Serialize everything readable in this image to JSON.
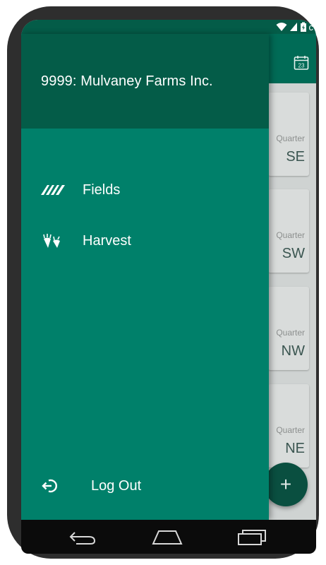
{
  "status_bar": {
    "battery_text": "c"
  },
  "drawer": {
    "account_name": "9999: Mulvaney Farms Inc.",
    "items": [
      {
        "label": "Fields",
        "icon": "fields-icon"
      },
      {
        "label": "Harvest",
        "icon": "harvest-icon"
      }
    ],
    "logout": {
      "label": "Log Out",
      "icon": "logout-icon"
    }
  },
  "background": {
    "calendar_day": "23",
    "cards": [
      {
        "label": "Quarter",
        "value": "SE"
      },
      {
        "label": "Quarter",
        "value": "SW"
      },
      {
        "label": "Quarter",
        "value": "NW"
      },
      {
        "label": "Quarter",
        "value": "NE"
      }
    ],
    "fab_symbol": "+"
  },
  "colors": {
    "drawer": "#00806a",
    "drawer_header": "#045c48",
    "app_bar": "#006b56",
    "fab": "#0a4f40"
  }
}
